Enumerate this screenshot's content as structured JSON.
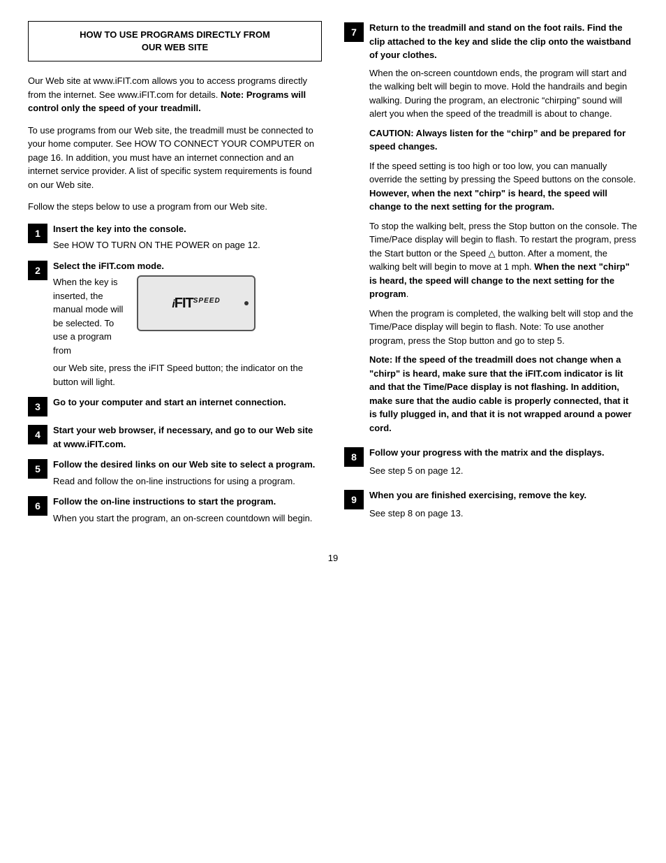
{
  "header": {
    "title_line1": "HOW TO USE PROGRAMS DIRECTLY FROM",
    "title_line2": "OUR WEB SITE"
  },
  "intro": {
    "para1": "Our Web site at www.iFIT.com allows you to access programs directly from the internet. See www.iFIT.com for details. Note: Programs will control only the speed of your treadmill.",
    "para1_bold": "Note: Programs will control only the speed of your treadmill.",
    "para2": "To use programs from our Web site, the treadmill must be connected to your home computer. See HOW TO CONNECT YOUR COMPUTER on page 16. In addition, you must have an internet connection and an internet service provider. A list of specific system requirements is found on our Web site.",
    "para3": "Follow the steps below to use a program from our Web site."
  },
  "steps_left": [
    {
      "num": "1",
      "title": "Insert the key into the console.",
      "body": "See HOW TO TURN ON THE POWER on page 12.",
      "body_bold": ""
    },
    {
      "num": "2",
      "title": "Select the iFIT.com mode.",
      "body_left": "When the key is inserted, the manual mode will be selected. To use a program from",
      "body_below": "our Web site, press the iFIT Speed button; the indicator on the button will light."
    },
    {
      "num": "3",
      "title": "Go to your computer and start an internet connection.",
      "body": ""
    },
    {
      "num": "4",
      "title": "Start your web browser, if necessary, and go to our Web site at www.iFIT.com.",
      "body": ""
    },
    {
      "num": "5",
      "title": "Follow the desired links on our Web site to select a program.",
      "body": "Read and follow the on-line instructions for using a program."
    },
    {
      "num": "6",
      "title": "Follow the on-line instructions to start the program.",
      "body": "When you start the program, an on-screen countdown will begin."
    }
  ],
  "steps_right": [
    {
      "num": "7",
      "title": "Return to the treadmill and stand on the foot rails. Find the clip attached to the key and slide the clip onto the waistband of your clothes.",
      "body1": "When the on-screen countdown ends, the program will start and the walking belt will begin to move. Hold the handrails and begin walking. During the program, an electronic “chirping” sound will alert you when the speed of the treadmill is about to change.",
      "caution": "CAUTION: Always listen for the “chirp” and be prepared for speed changes.",
      "body2": "If the speed setting is too high or too low, you can manually override the setting by pressing the Speed buttons on the console.",
      "bold2": "However, when the next “chirp” is heard, the speed will change to the next setting for the program.",
      "body3": "To stop the walking belt, press the Stop button on the console. The Time/Pace display will begin to flash. To restart the program, press the Start button or the Speed △ button. After a moment, the walking belt will begin to move at 1 mph.",
      "bold3": "When the next “chirp” is heard, the speed will change to the next setting for the program",
      "body3_end": ".",
      "body4": "When the program is completed, the walking belt will stop and the Time/Pace display will begin to flash. Note: To use another program, press the Stop button and go to step 5.",
      "note": "Note: If the speed of the treadmill does not change when a “chirp” is heard, make sure that the iFIT.com indicator is lit and that the Time/Pace display is not flashing. In addition, make sure that the audio cable is properly connected, that it is fully plugged in, and that it is not wrapped around a power cord."
    },
    {
      "num": "8",
      "title": "Follow your progress with the matrix and the displays.",
      "body": "See step 5 on page 12."
    },
    {
      "num": "9",
      "title": "When you are finished exercising, remove the key.",
      "body": "See step 8 on page 13."
    }
  ],
  "page_number": "19",
  "ifit_display": {
    "logo_i": "i",
    "logo_fit": "FIT",
    "logo_speed": "SPEED"
  }
}
